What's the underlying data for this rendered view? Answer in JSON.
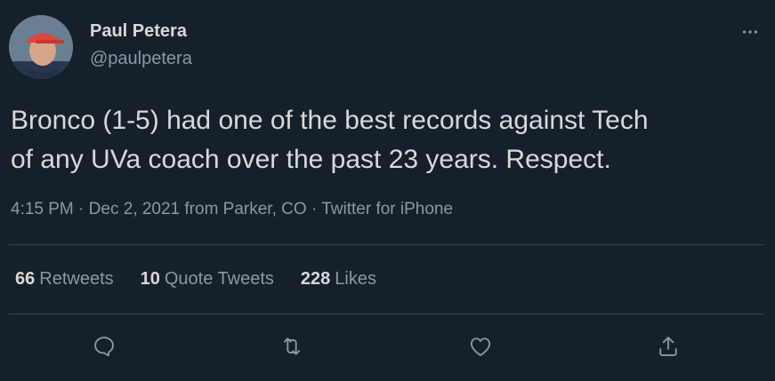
{
  "author": {
    "display_name": "Paul Petera",
    "handle": "@paulpetera"
  },
  "tweet": {
    "text": "Bronco (1-5) had one of the best records against Tech\nof any UVa coach over the past 23 years. Respect.",
    "time": "4:15 PM",
    "date": "Dec 2, 2021 from Parker, CO",
    "source": "Twitter for iPhone",
    "separator": "·"
  },
  "stats": {
    "retweets_count": "66",
    "retweets_label": "Retweets",
    "quotes_count": "10",
    "quotes_label": "Quote Tweets",
    "likes_count": "228",
    "likes_label": "Likes"
  },
  "icons": {
    "more": "more-dots-icon",
    "reply": "reply-icon",
    "retweet": "retweet-icon",
    "like": "heart-icon",
    "share": "share-icon"
  },
  "colors": {
    "background": "#15202b",
    "text": "#d9d9d9",
    "secondary_text": "#8b98a5",
    "divider": "#38444d"
  }
}
